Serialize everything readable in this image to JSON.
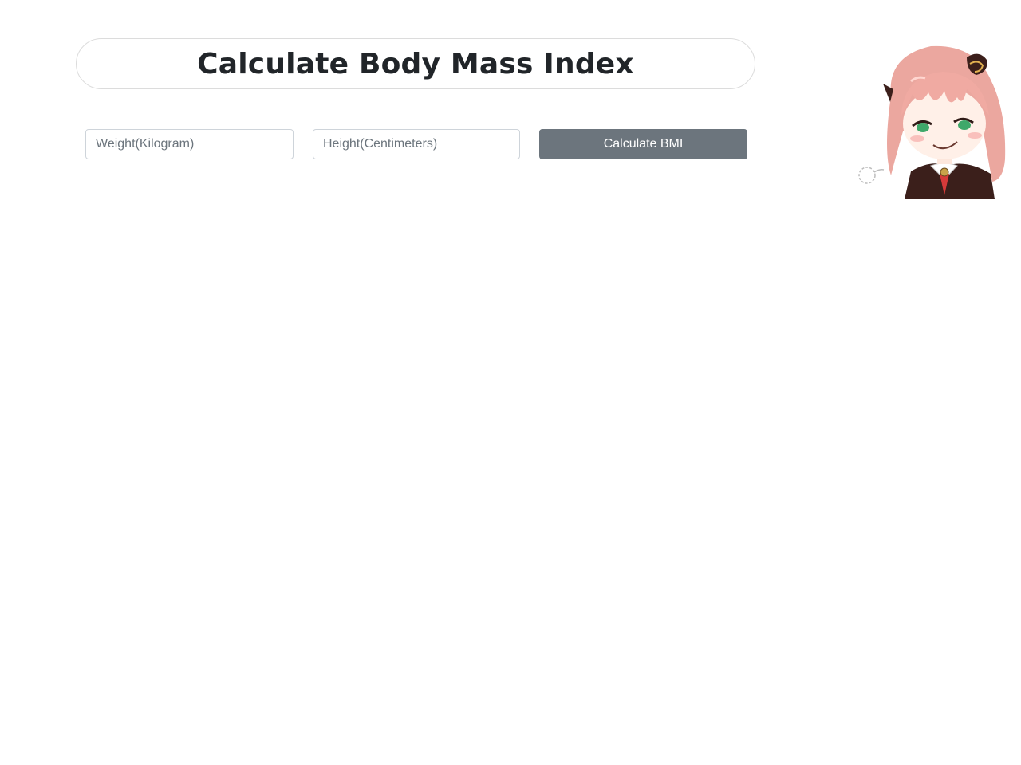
{
  "header": {
    "title": "Calculate Body Mass Index"
  },
  "form": {
    "weight_placeholder": "Weight(Kilogram)",
    "weight_value": "",
    "height_placeholder": "Height(Centimeters)",
    "height_value": "",
    "calculate_label": "Calculate BMI"
  },
  "decor": {
    "mascot_icon": "anime-girl-mascot-icon"
  },
  "colors": {
    "button_bg": "#6c757d",
    "title_text": "#212529",
    "border": "#ced4da"
  }
}
